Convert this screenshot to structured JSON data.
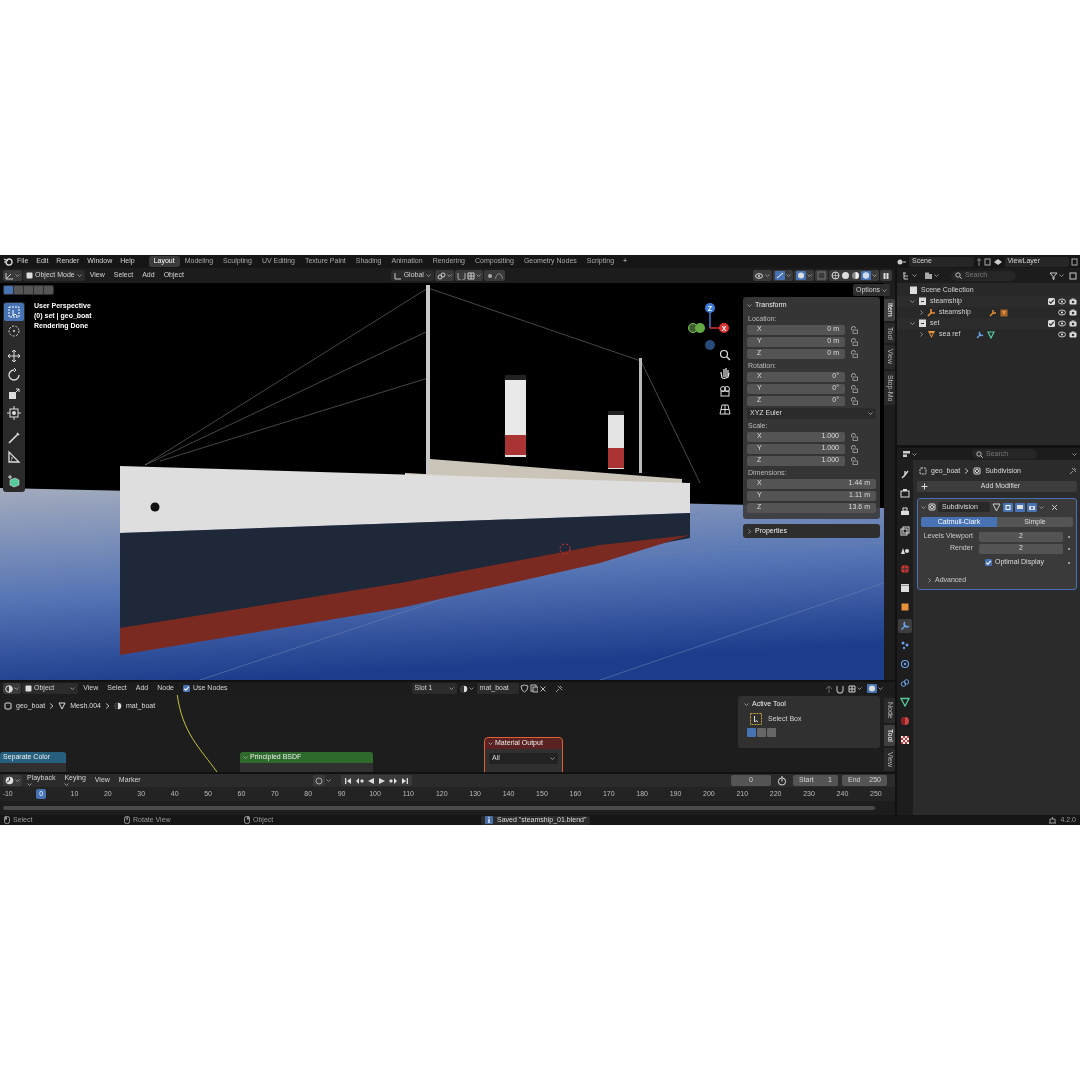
{
  "top_bar": {
    "menus": [
      "File",
      "Edit",
      "Render",
      "Window",
      "Help"
    ],
    "workspaces": [
      {
        "label": "Layout",
        "selected": true
      },
      {
        "label": "Modeling",
        "selected": false
      },
      {
        "label": "Sculpting",
        "selected": false
      },
      {
        "label": "UV Editing",
        "selected": false
      },
      {
        "label": "Texture Paint",
        "selected": false
      },
      {
        "label": "Shading",
        "selected": false
      },
      {
        "label": "Animation",
        "selected": false
      },
      {
        "label": "Rendering",
        "selected": false
      },
      {
        "label": "Compositing",
        "selected": false
      },
      {
        "label": "Geometry Nodes",
        "selected": false
      },
      {
        "label": "Scripting",
        "selected": false
      }
    ],
    "add_workspace": "+",
    "scene": "Scene",
    "view_layer": "ViewLayer"
  },
  "viewport": {
    "mode": "Object Mode",
    "menus": [
      "View",
      "Select",
      "Add",
      "Object"
    ],
    "orientation": "Global",
    "options": "Options",
    "info": [
      "User Perspective",
      "(0) set | geo_boat",
      "Rendering Done"
    ],
    "select_modes": [
      {
        "selected": true
      },
      {
        "selected": false
      },
      {
        "selected": false
      },
      {
        "selected": false
      },
      {
        "selected": false
      }
    ],
    "tools": [
      {
        "kind": "select",
        "selected": true
      },
      {
        "kind": "cursor",
        "selected": false
      },
      {
        "kind": "move",
        "selected": false
      },
      {
        "kind": "rotate",
        "selected": false
      },
      {
        "kind": "scale",
        "selected": false
      },
      {
        "kind": "transform",
        "selected": false
      },
      {
        "kind": "annotate",
        "selected": false
      },
      {
        "kind": "measure",
        "selected": false
      },
      {
        "kind": "add_cube",
        "selected": false
      }
    ],
    "gizmo_labels": [
      "Z",
      "X"
    ],
    "transform": {
      "title": "Transform",
      "groups": [
        {
          "label": "Location:",
          "lock_icons": true,
          "rows": [
            {
              "axis": "X",
              "value": "0 m"
            },
            {
              "axis": "Y",
              "value": "0 m"
            },
            {
              "axis": "Z",
              "value": "0 m"
            }
          ]
        },
        {
          "label": "Rotation:",
          "lock_icons": true,
          "rows": [
            {
              "axis": "X",
              "value": "0°"
            },
            {
              "axis": "Y",
              "value": "0°"
            },
            {
              "axis": "Z",
              "value": "0°"
            }
          ],
          "mode": "XYZ Euler"
        },
        {
          "label": "Scale:",
          "lock_icons": true,
          "rows": [
            {
              "axis": "X",
              "value": "1.000"
            },
            {
              "axis": "Y",
              "value": "1.000"
            },
            {
              "axis": "Z",
              "value": "1.000"
            }
          ]
        },
        {
          "label": "Dimensions:",
          "lock_icons": false,
          "rows": [
            {
              "axis": "X",
              "value": "1.44 m"
            },
            {
              "axis": "Y",
              "value": "1.11 m"
            },
            {
              "axis": "Z",
              "value": "13.6 m"
            }
          ]
        }
      ]
    },
    "properties_panel": {
      "label": "Properties",
      "expanded": false
    },
    "tabs": [
      {
        "label": "Item",
        "selected": true
      },
      {
        "label": "Tool",
        "selected": false
      },
      {
        "label": "View",
        "selected": false
      },
      {
        "label": "Stop-Mo",
        "selected": false
      }
    ]
  },
  "node_editor": {
    "type": "Object",
    "menus": [
      "View",
      "Select",
      "Add",
      "Node"
    ],
    "use_nodes": {
      "label": "Use Nodes",
      "checked": true
    },
    "slot": "Slot 1",
    "material": "mat_boat",
    "breadcrumbs": [
      {
        "kind": "object",
        "label": "geo_boat"
      },
      {
        "kind": "mesh",
        "label": "Mesh.004"
      },
      {
        "kind": "material",
        "label": "mat_boat"
      }
    ],
    "nodes": [
      {
        "kind": "separate_color",
        "title": "Separate Color"
      },
      {
        "kind": "principled",
        "title": "Principled BSDF"
      },
      {
        "kind": "output",
        "title": "Material Output",
        "target": "All"
      }
    ],
    "side_panel": {
      "title": "Active Tool",
      "tool": "Select Box",
      "modes": [
        {
          "selected": true
        },
        {
          "selected": false
        },
        {
          "selected": false
        }
      ]
    },
    "tabs": [
      {
        "label": "Node",
        "selected": false
      },
      {
        "label": "Tool",
        "selected": true
      },
      {
        "label": "View",
        "selected": false
      }
    ]
  },
  "timeline": {
    "menus": [
      "Playback",
      "Keying",
      "View",
      "Marker"
    ],
    "frame": "0",
    "start_label": "Start",
    "start": "1",
    "end_label": "End",
    "end": "250",
    "ticks": [
      {
        "label": "-10",
        "current": false
      },
      {
        "label": "0",
        "current": true
      },
      {
        "label": "10",
        "current": false
      },
      {
        "label": "20",
        "current": false
      },
      {
        "label": "30",
        "current": false
      },
      {
        "label": "40",
        "current": false
      },
      {
        "label": "50",
        "current": false
      },
      {
        "label": "60",
        "current": false
      },
      {
        "label": "70",
        "current": false
      },
      {
        "label": "80",
        "current": false
      },
      {
        "label": "90",
        "current": false
      },
      {
        "label": "100",
        "current": false
      },
      {
        "label": "110",
        "current": false
      },
      {
        "label": "120",
        "current": false
      },
      {
        "label": "130",
        "current": false
      },
      {
        "label": "140",
        "current": false
      },
      {
        "label": "150",
        "current": false
      },
      {
        "label": "160",
        "current": false
      },
      {
        "label": "170",
        "current": false
      },
      {
        "label": "180",
        "current": false
      },
      {
        "label": "190",
        "current": false
      },
      {
        "label": "200",
        "current": false
      },
      {
        "label": "210",
        "current": false
      },
      {
        "label": "220",
        "current": false
      },
      {
        "label": "230",
        "current": false
      },
      {
        "label": "240",
        "current": false
      },
      {
        "label": "250",
        "current": false
      }
    ]
  },
  "status_bar": {
    "hints": [
      {
        "kind": "left",
        "label": "Select"
      },
      {
        "kind": "middle",
        "label": "Rotate View"
      },
      {
        "kind": "right",
        "label": "Object"
      }
    ],
    "report": "Saved \"steamship_01.blend\"",
    "version": "4.2.0"
  },
  "outliner": {
    "search_placeholder": "Search",
    "root": "Scene Collection",
    "tree": [
      {
        "kind": "collection",
        "label": "steamship",
        "expanded": true,
        "checked": true,
        "children": [
          {
            "kind": "armature",
            "label": "steamship",
            "expanded": false
          }
        ]
      },
      {
        "kind": "collection",
        "label": "set",
        "expanded": true,
        "checked": true,
        "children": [
          {
            "kind": "mesh",
            "label": "sea ref",
            "expanded": false
          }
        ]
      }
    ]
  },
  "properties": {
    "search_placeholder": "Search",
    "tabs": [
      {
        "kind": "tool",
        "selected": false
      },
      {
        "kind": "render",
        "selected": false
      },
      {
        "kind": "output",
        "selected": false
      },
      {
        "kind": "view_layer",
        "selected": false
      },
      {
        "kind": "scene",
        "selected": false
      },
      {
        "kind": "world",
        "selected": false
      },
      {
        "kind": "collection",
        "selected": false
      },
      {
        "kind": "object",
        "selected": false
      },
      {
        "kind": "modifiers",
        "selected": true
      },
      {
        "kind": "particles",
        "selected": false
      },
      {
        "kind": "physics",
        "selected": false
      },
      {
        "kind": "constraints",
        "selected": false
      },
      {
        "kind": "data",
        "selected": false
      },
      {
        "kind": "material",
        "selected": false
      },
      {
        "kind": "texture",
        "selected": false
      }
    ],
    "breadcrumb": [
      "geo_boat",
      "Subdivision"
    ],
    "add_modifier": "Add Modifier",
    "modifier": {
      "name": "Subdivision",
      "expanded": true,
      "methods": [
        {
          "label": "Catmull-Clark",
          "selected": true
        },
        {
          "label": "Simple",
          "selected": false
        }
      ],
      "fields": [
        {
          "label": "Levels Viewport",
          "value": "2"
        },
        {
          "label": "Render",
          "value": "2"
        }
      ],
      "optimal_display": {
        "label": "Optimal Display",
        "checked": true
      },
      "advanced": {
        "label": "Advanced",
        "expanded": false
      }
    }
  }
}
